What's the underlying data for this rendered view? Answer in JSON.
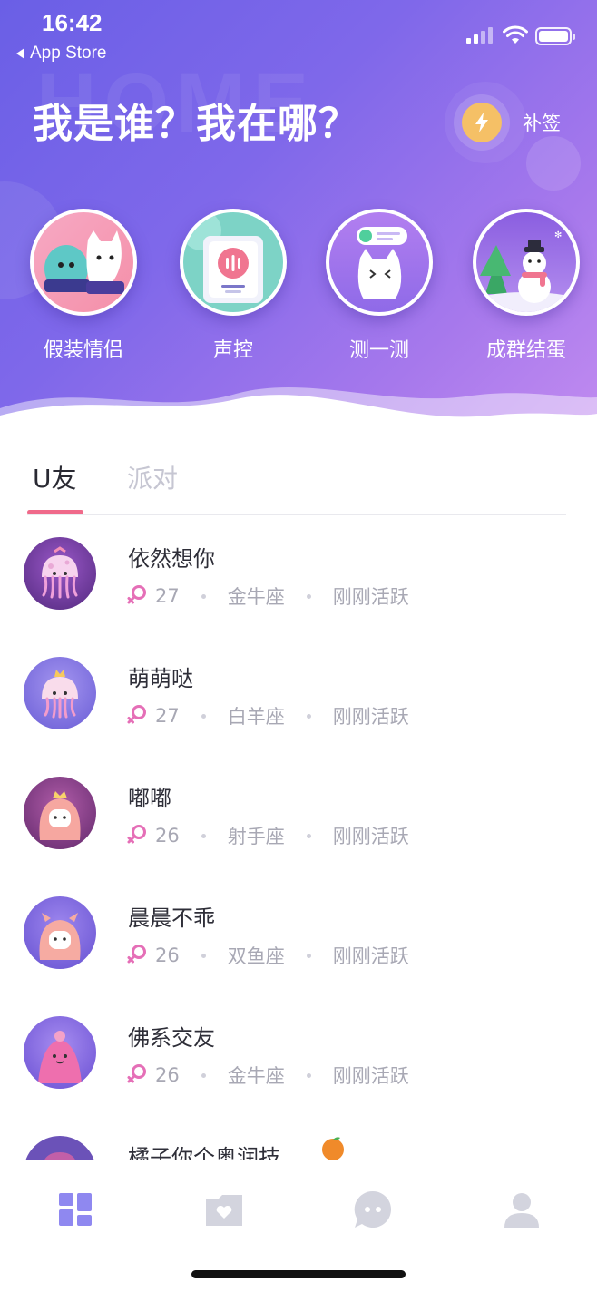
{
  "status_bar": {
    "time": "16:42",
    "back_app": "App Store"
  },
  "header": {
    "title": "我是谁？我在哪？",
    "watermark": "HOME",
    "signin_label": "补签",
    "signin_icon": "lightning-bolt-icon"
  },
  "features": [
    {
      "label": "假装情侣",
      "icon": "fake-couple-icon"
    },
    {
      "label": "声控",
      "icon": "voice-control-icon"
    },
    {
      "label": "测一测",
      "icon": "quiz-icon"
    },
    {
      "label": "成群结蛋",
      "icon": "group-snowman-icon"
    }
  ],
  "tabs": {
    "active": "U友",
    "inactive": "派对"
  },
  "users": [
    {
      "name": "依然想你",
      "age": "27",
      "zodiac": "金牛座",
      "status": "刚刚活跃",
      "gender_icon": "female-icon"
    },
    {
      "name": "萌萌哒",
      "age": "27",
      "zodiac": "白羊座",
      "status": "刚刚活跃",
      "gender_icon": "female-icon"
    },
    {
      "name": "嘟嘟",
      "age": "26",
      "zodiac": "射手座",
      "status": "刚刚活跃",
      "gender_icon": "female-icon"
    },
    {
      "name": "晨晨不乖",
      "age": "26",
      "zodiac": "双鱼座",
      "status": "刚刚活跃",
      "gender_icon": "female-icon"
    },
    {
      "name": "佛系交友",
      "age": "26",
      "zodiac": "金牛座",
      "status": "刚刚活跃",
      "gender_icon": "female-icon"
    },
    {
      "name": "橘子你个奥润技",
      "emoji": "orange-emoji-icon"
    }
  ],
  "bottom_nav": [
    {
      "icon": "dashboard-icon",
      "active": true
    },
    {
      "icon": "heart-folder-icon",
      "active": false
    },
    {
      "icon": "chat-bubble-icon",
      "active": false
    },
    {
      "icon": "profile-icon",
      "active": false
    }
  ],
  "colors": {
    "header_gradient_start": "#6a5fe6",
    "header_gradient_end": "#c18bf0",
    "accent_pink": "#f06a8a",
    "female_pink": "#e56fb7",
    "nav_active": "#8f88f0",
    "nav_inactive": "#d3d4de"
  }
}
